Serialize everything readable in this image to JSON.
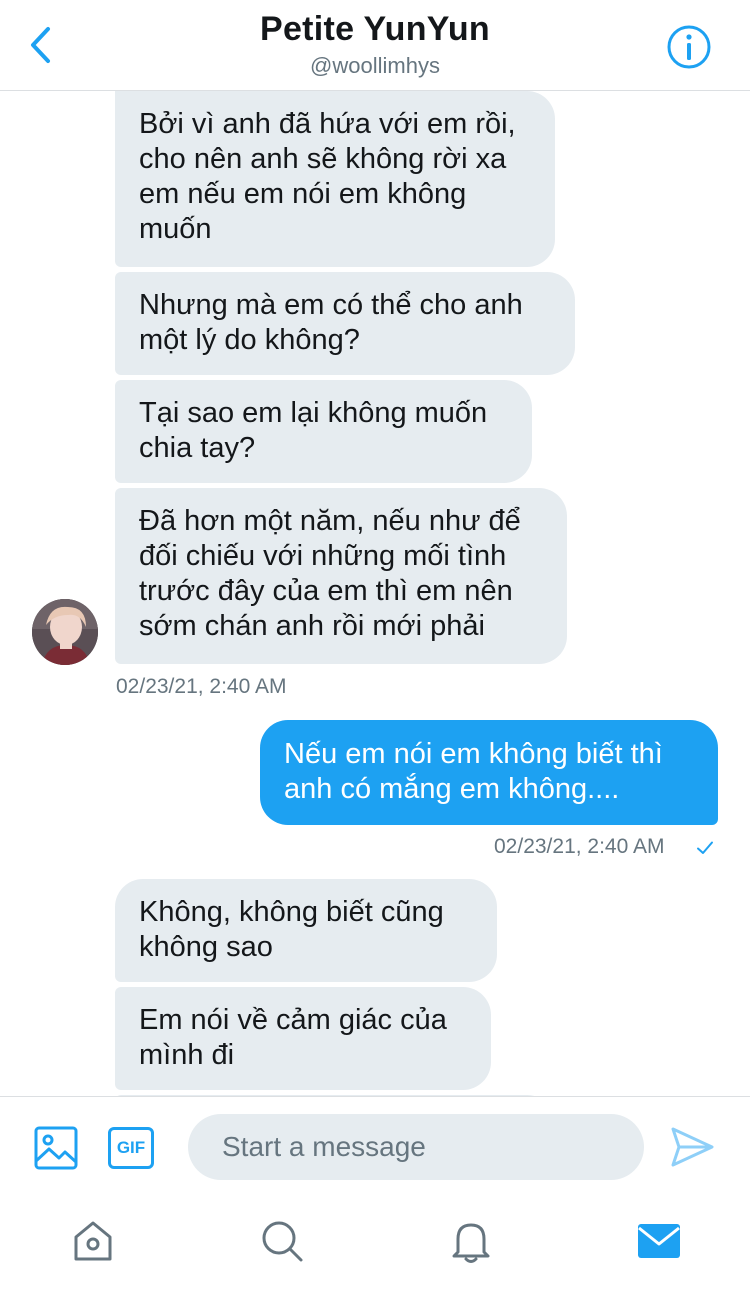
{
  "header": {
    "title": "Petite YunYun",
    "handle": "@woollimhys",
    "back_icon": "chevron-left-icon",
    "info_icon": "info-circle-icon"
  },
  "conversation": {
    "incoming_group_1": [
      "Bởi vì anh đã hứa với em rồi,\ncho nên anh sẽ không rời xa\nem nếu em nói em không\nmuốn",
      "Nhưng mà em có thể cho anh\nmột lý do không?",
      "Tại sao em lại không muốn\nchia tay?",
      "Đã hơn một năm, nếu như để\nđối chiếu với những mối tình\ntrước đây của em thì em nên\nsớm chán anh rồi mới phải"
    ],
    "incoming_group_1_time": "02/23/21, 2:40 AM",
    "outgoing": "Nếu em nói em không biết thì\nanh có mắng em không....",
    "outgoing_time": "02/23/21, 2:40 AM",
    "incoming_group_2": [
      "Không, không biết cũng\nkhông sao",
      "Em nói về cảm giác của\nmình đi"
    ]
  },
  "composer": {
    "placeholder": "Start a message",
    "gif_label": "GIF",
    "media_icon": "image-icon",
    "send_icon": "send-icon"
  },
  "tabbar": {
    "items": [
      "home-icon",
      "search-icon",
      "bell-icon",
      "mail-icon"
    ],
    "active": "mail-icon"
  },
  "colors": {
    "accent": "#1da1f2",
    "incoming_bubble": "#e6ecf0",
    "secondary_text": "#66757f"
  }
}
